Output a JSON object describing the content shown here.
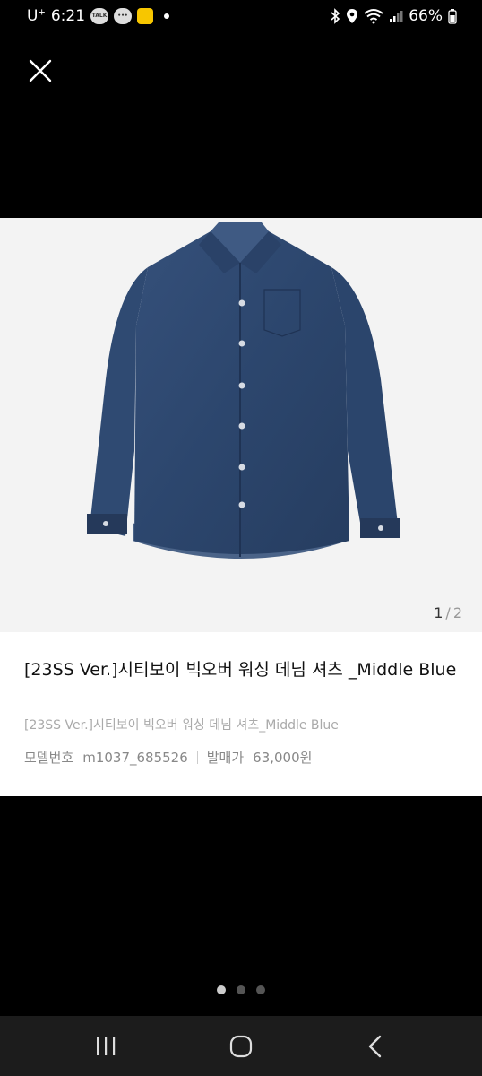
{
  "status_bar": {
    "carrier": "U",
    "carrier_sup": "+",
    "time": "6:21",
    "notif_talk": "TALK",
    "battery": "66%"
  },
  "close": {
    "icon": "close-icon"
  },
  "gallery": {
    "current": "1",
    "separator": "/",
    "total": "2",
    "image": "denim-shirt-image"
  },
  "product": {
    "title": "[23SS Ver.]시티보이 빅오버 워싱 데님 셔츠 _Middle Blue",
    "subtitle": "[23SS Ver.]시티보이 빅오버 워싱 데님 셔츠_Middle Blue",
    "model_label": "모델번호",
    "model_value": "m1037_685526",
    "price_label": "발매가",
    "price_value": "63,000원"
  },
  "page_dots": {
    "count": 3,
    "active_index": 0
  },
  "nav": {
    "recents": "recents-icon",
    "home": "home-icon",
    "back": "back-icon"
  },
  "colors": {
    "background": "#000000",
    "card": "#ffffff",
    "image_bg": "#f3f3f3",
    "denim": "#2f4a72"
  }
}
